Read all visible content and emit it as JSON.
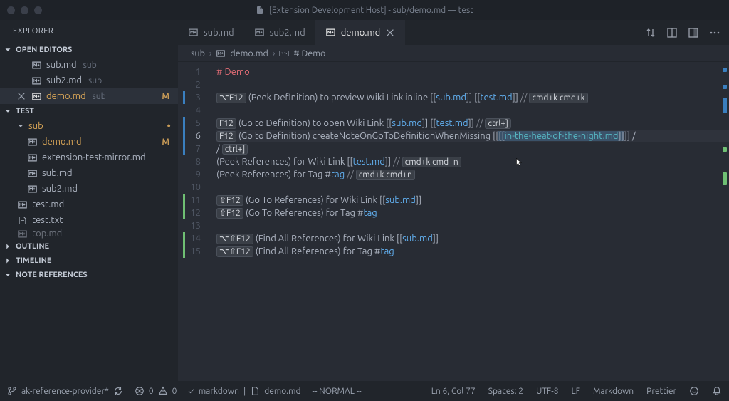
{
  "window": {
    "title": "[Extension Development Host] - sub/demo.md — test"
  },
  "sidebar": {
    "header": "EXPLORER",
    "open_editors_label": "OPEN EDITORS",
    "test_label": "TEST",
    "outline_label": "OUTLINE",
    "timeline_label": "TIMELINE",
    "note_refs_label": "NOTE REFERENCES",
    "open_editors": [
      {
        "name": "sub.md",
        "desc": "sub"
      },
      {
        "name": "sub2.md",
        "desc": "sub"
      },
      {
        "name": "demo.md",
        "desc": "sub",
        "modified": "M",
        "active": true
      }
    ],
    "folder_sub": "sub",
    "tree": [
      {
        "name": "demo.md",
        "depth": 1,
        "modified": "M",
        "icon": "md"
      },
      {
        "name": "extension-test-mirror.md",
        "depth": 1,
        "icon": "md"
      },
      {
        "name": "sub.md",
        "depth": 1,
        "icon": "md"
      },
      {
        "name": "sub2.md",
        "depth": 1,
        "icon": "md"
      },
      {
        "name": "test.md",
        "depth": 0,
        "icon": "md"
      },
      {
        "name": "test.txt",
        "depth": 0,
        "icon": "txt"
      },
      {
        "name": "top.md",
        "depth": 0,
        "icon": "md"
      }
    ]
  },
  "tabs": {
    "items": [
      {
        "label": "sub.md",
        "active": false
      },
      {
        "label": "sub2.md",
        "active": false
      },
      {
        "label": "demo.md",
        "active": true
      }
    ]
  },
  "breadcrumbs": {
    "crumb0": "sub",
    "crumb1": "demo.md",
    "crumb2": "# Demo"
  },
  "code": {
    "l1_hash": "#",
    "l1_title": "Demo",
    "l3_kbd": "⌥F12",
    "l3_text": " (Peek Definition) to preview Wiki Link inline [[",
    "l3_link1": "sub.md",
    "l3_mid": "]] [[",
    "l3_link2": "test.md",
    "l3_end": "]] ",
    "l3_cmt": "// ",
    "l3_kbd2": "cmd+k cmd+k",
    "l4_kbd": "F12",
    "l4_text": " (Go to Definition) to open Wiki Link [[",
    "l4_link1": "sub.md",
    "l4_mid": "]] [[",
    "l4_link2": "test.md",
    "l4_end": "]] ",
    "l4_cmt": "// ",
    "l4_kbd2": "ctrl+]",
    "l5_kbd": "F12",
    "l5_text": " (Go to Definition) createNoteOnGoToDefinitionWhenMissing [[",
    "l5_link": "in-the-heat-of-the-night.md",
    "l5_end": "]] /",
    "l6_text": "/ ",
    "l6_kbd": "ctrl+]",
    "l7_text": "(Peek References) for Wiki Link [[",
    "l7_link": "test.md",
    "l7_end": "]] ",
    "l7_cmt": "// ",
    "l7_kbd": "cmd+k cmd+n",
    "l8_text": "(Peek References) for Tag #",
    "l8_tag": "tag",
    "l8_cmt": " // ",
    "l8_kbd": "cmd+k cmd+n",
    "l9_kbd": "⇧F12",
    "l9_text": " (Go To References) for Wiki Link [[",
    "l9_link": "sub.md",
    "l9_end": "]]",
    "l10_kbd": "⇧F12",
    "l10_text": " (Go To References) for Tag #",
    "l10_tag": "tag",
    "l11_kbd": "⌥⇧F12",
    "l11_text": " (Find All References) for Wiki Link [[",
    "l11_link": "sub.md",
    "l11_end": "]]",
    "l12_kbd": "⌥⇧F12",
    "l12_text": " (Find All References) for Tag #",
    "l12_tag": "tag",
    "gutter": [
      "1",
      "2",
      "3",
      "4",
      "5",
      "6",
      "7",
      "8",
      "9",
      "10",
      "11",
      "12",
      "13",
      "14",
      "15"
    ]
  },
  "status": {
    "git_branch": "ak-reference-provider*",
    "errors": "0",
    "warnings": "0",
    "lang_check": "markdown",
    "filename": "demo.md",
    "vim_mode": "-- NORMAL --",
    "position": "Ln 6, Col 77",
    "spaces": "Spaces: 2",
    "encoding": "UTF-8",
    "eol": "LF",
    "language": "Markdown",
    "formatter": "Prettier"
  }
}
